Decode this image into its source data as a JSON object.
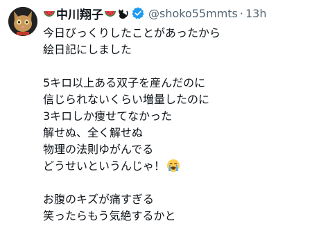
{
  "tweet": {
    "display_name": "中川翔子",
    "name_emojis": [
      "watermelon-icon",
      "watermelon-icon",
      "black-cat-icon"
    ],
    "verified_icon": "verified-badge-icon",
    "handle": "@shoko55mmts",
    "separator": "·",
    "time": "13h",
    "body_lines": [
      "今日びっくりしたことがあったから",
      "絵日記にしました",
      "",
      "5キロ以上ある双子を産んだのに",
      "信じられないくらい増量したのに",
      "3キロしか痩せてなかった",
      "解せぬ、全く解せぬ",
      "物理の法則ゆがんでる",
      "どうせいというんじゃ！",
      "",
      "お腹のキズが痛すぎる",
      "笑ったらもう気絶するかと"
    ],
    "line9_emoji": "loudly-crying-face-icon"
  },
  "colors": {
    "text": "#0f1419",
    "secondary": "#536471",
    "verified": "#1d9bf0"
  }
}
